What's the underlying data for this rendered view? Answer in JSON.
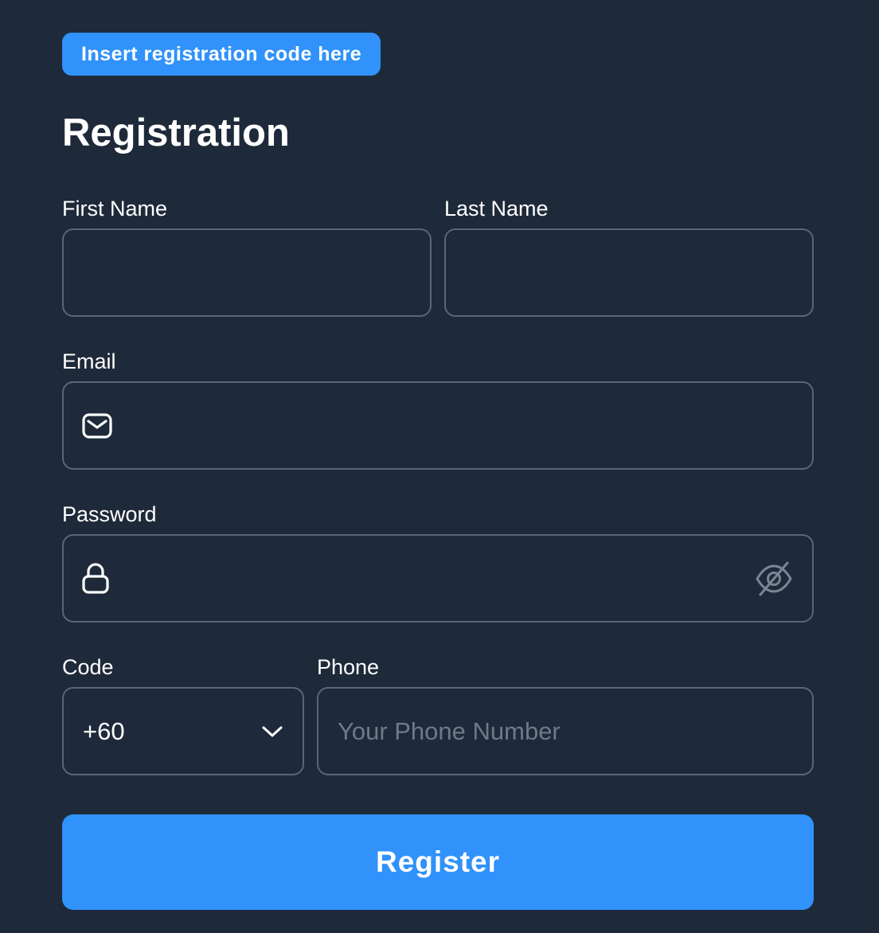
{
  "registration_code_button": {
    "label": "Insert registration code here"
  },
  "form": {
    "title": "Registration",
    "first_name": {
      "label": "First Name",
      "value": "",
      "placeholder": ""
    },
    "last_name": {
      "label": "Last Name",
      "value": "",
      "placeholder": ""
    },
    "email": {
      "label": "Email",
      "value": "",
      "placeholder": "",
      "icon": "mail-icon"
    },
    "password": {
      "label": "Password",
      "value": "",
      "placeholder": "",
      "icon": "lock-icon",
      "toggle_icon": "eye-off-icon"
    },
    "code": {
      "label": "Code",
      "selected": "+60",
      "icon": "chevron-down-icon"
    },
    "phone": {
      "label": "Phone",
      "value": "",
      "placeholder": "Your Phone Number"
    },
    "submit_label": "Register"
  },
  "colors": {
    "background": "#1e2a3a",
    "accent": "#3092fa",
    "border": "#5a6676",
    "placeholder": "#6f7a88",
    "text": "#ffffff"
  }
}
